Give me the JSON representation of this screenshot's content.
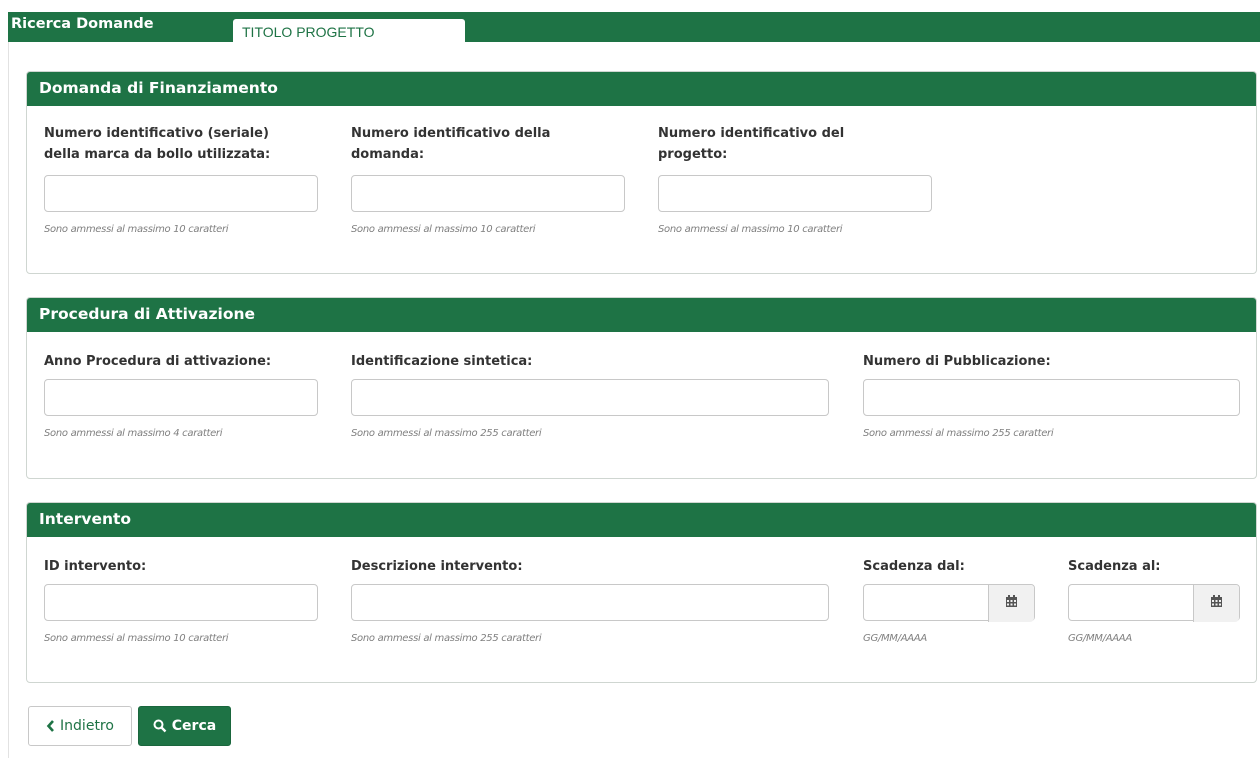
{
  "header": {
    "title": "Ricerca Domande",
    "tab_label": "TITOLO PROGETTO"
  },
  "sections": {
    "domanda": {
      "title": "Domanda di Finanziamento",
      "fields": [
        {
          "label": "Numero identificativo (seriale) della marca da bollo utilizzata:",
          "value": "",
          "help": "Sono ammessi al massimo 10 caratteri"
        },
        {
          "label": "Numero identificativo della domanda:",
          "value": "",
          "help": "Sono ammessi al massimo 10 caratteri"
        },
        {
          "label": "Numero identificativo del progetto:",
          "value": "",
          "help": "Sono ammessi al massimo 10 caratteri"
        }
      ]
    },
    "procedura": {
      "title": "Procedura di Attivazione",
      "fields": [
        {
          "label": "Anno Procedura di attivazione:",
          "value": "",
          "help": "Sono ammessi al massimo 4 caratteri"
        },
        {
          "label": "Identificazione sintetica:",
          "value": "",
          "help": "Sono ammessi al massimo 255 caratteri"
        },
        {
          "label": "Numero di Pubblicazione:",
          "value": "",
          "help": "Sono ammessi al massimo 255 caratteri"
        }
      ]
    },
    "intervento": {
      "title": "Intervento",
      "fields": [
        {
          "label": "ID intervento:",
          "value": "",
          "help": "Sono ammessi al massimo 10 caratteri"
        },
        {
          "label": "Descrizione intervento:",
          "value": "",
          "help": "Sono ammessi al massimo 255 caratteri"
        },
        {
          "label": "Scadenza dal:",
          "value": "",
          "help": "GG/MM/AAAA",
          "icon": "calendar-icon"
        },
        {
          "label": "Scadenza al:",
          "value": "",
          "help": "GG/MM/AAAA",
          "icon": "calendar-icon"
        }
      ]
    }
  },
  "actions": {
    "back_label": "Indietro",
    "back_icon": "chevron-left-icon",
    "search_label": "Cerca",
    "search_icon": "search-icon"
  },
  "colors": {
    "primary_green": "#1e7345",
    "border": "#c8c8c8",
    "help_text": "#808080"
  }
}
